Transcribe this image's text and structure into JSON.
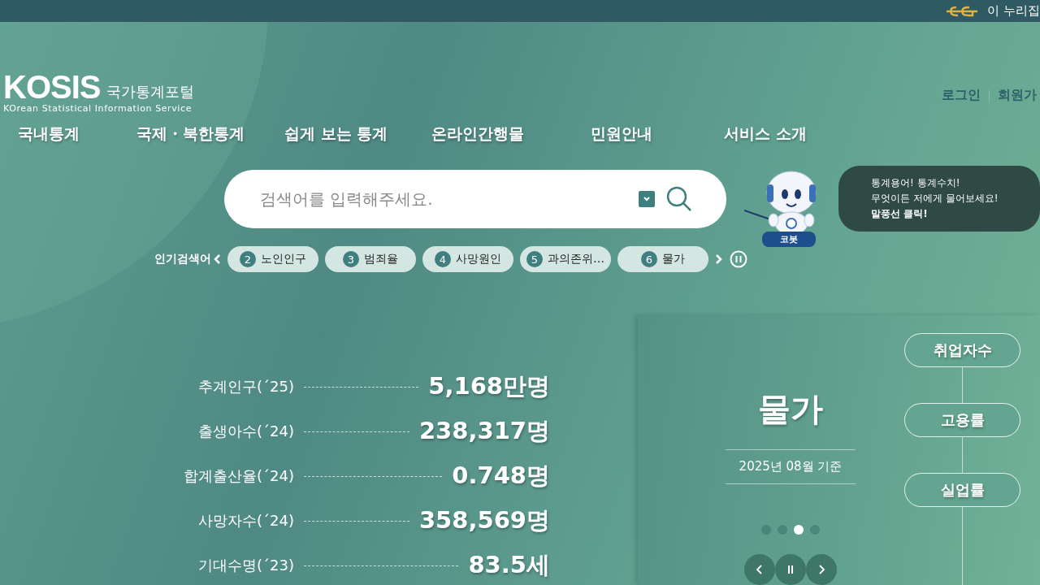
{
  "top_bar": {
    "text": "이 누리집"
  },
  "logo": {
    "wordmark": "KOSIS",
    "title": "국가통계포털",
    "subtitle": "KOrean Statistical Information Service"
  },
  "account_links": [
    "로그인",
    "회원가"
  ],
  "nav": [
    "국내통계",
    "국제・북한통계",
    "쉽게 보는 통계",
    "온라인간행물",
    "민원안내",
    "서비스 소개"
  ],
  "search": {
    "placeholder": "검색어를 입력해주세요."
  },
  "chatbot": {
    "name": "코봇",
    "bubble_lines": [
      "통계용어! 통계수치!",
      "무엇이든 저에게 물어보세요!",
      "**말풍선 클릭!**"
    ]
  },
  "popular": {
    "label": "인기검색어",
    "keywords": [
      {
        "rank": "2",
        "text": "노인인구"
      },
      {
        "rank": "3",
        "text": "범죄율"
      },
      {
        "rank": "4",
        "text": "사망원인"
      },
      {
        "rank": "5",
        "text": "과의존위…"
      },
      {
        "rank": "6",
        "text": "물가"
      }
    ]
  },
  "stats": [
    {
      "label": "추계인구(´25)",
      "value": "5,168만명"
    },
    {
      "label": "출생아수(´24)",
      "value": "238,317명"
    },
    {
      "label": "합계출산율(´24)",
      "value": "0.748명"
    },
    {
      "label": "사망자수(´24)",
      "value": "358,569명"
    },
    {
      "label": "기대수명(´23)",
      "value": "83.5세"
    }
  ],
  "indicator": {
    "title": "물가",
    "date": "2025년 08월 기준",
    "dots": [
      {
        "selected": false
      },
      {
        "selected": false
      },
      {
        "selected": true
      },
      {
        "selected": false
      }
    ]
  },
  "indicator_tabs": [
    "취업자수",
    "고용률",
    "실업률"
  ]
}
